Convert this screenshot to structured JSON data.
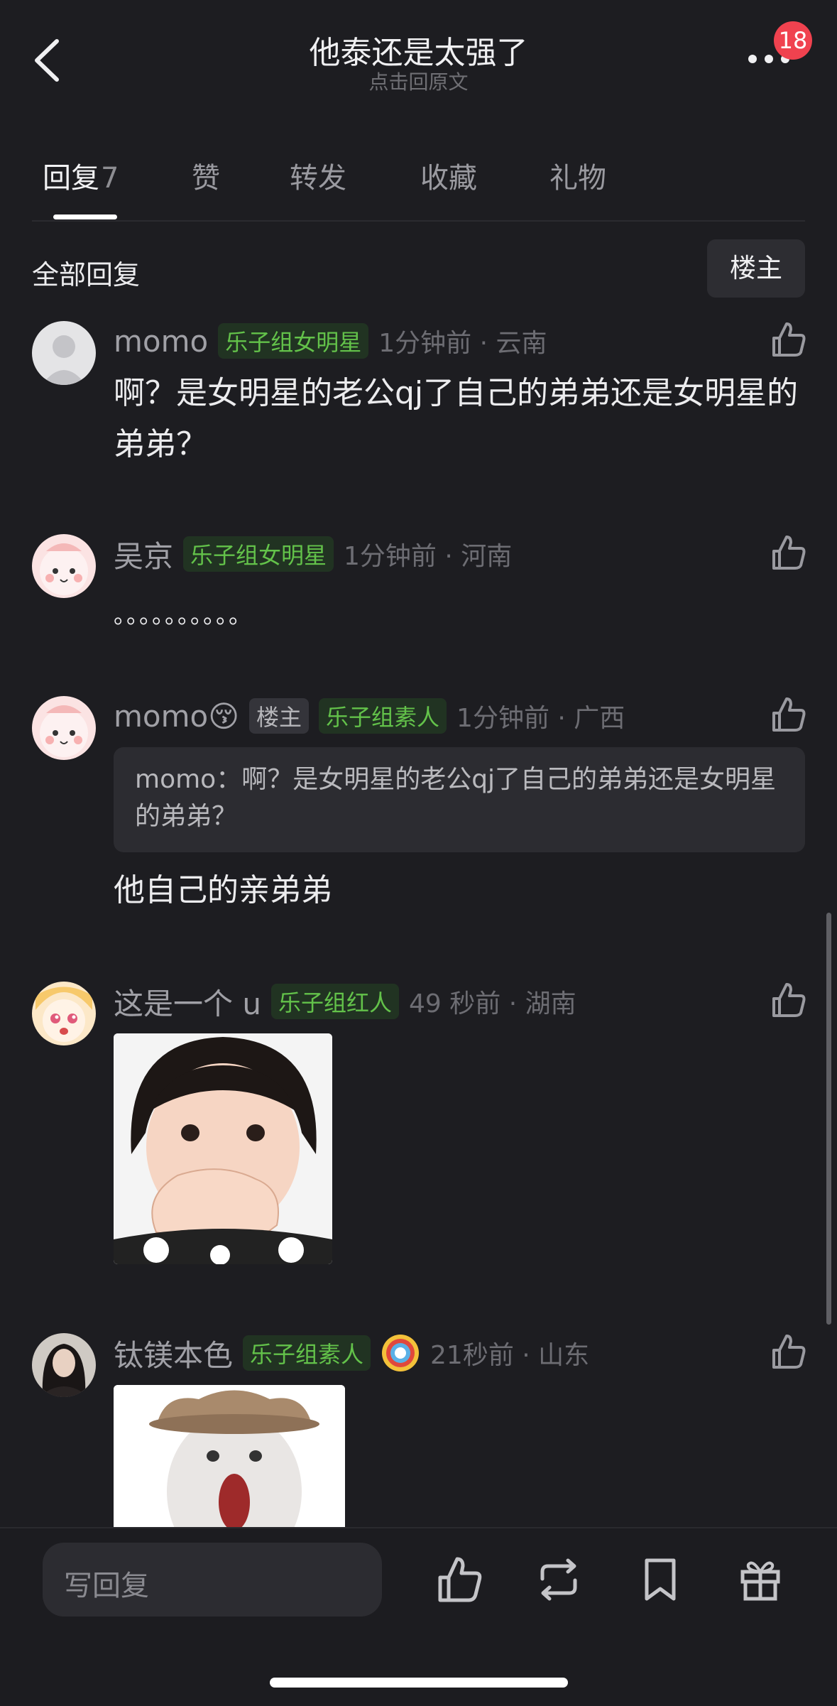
{
  "header": {
    "title": "他泰还是太强了",
    "subtitle": "点击回原文",
    "badge": "18"
  },
  "tabs": [
    {
      "label": "回复",
      "count": "7"
    },
    {
      "label": "赞"
    },
    {
      "label": "转发"
    },
    {
      "label": "收藏"
    },
    {
      "label": "礼物"
    }
  ],
  "section": {
    "title": "全部回复",
    "op_button": "楼主"
  },
  "comments": [
    {
      "name": "momo",
      "tag": "乐子组女明星",
      "meta": "1分钟前 · 云南",
      "text": "啊？是女明星的老公qj了自己的弟弟还是女明星的弟弟？"
    },
    {
      "name": "吴京",
      "tag": "乐子组女明星",
      "meta": "1分钟前 · 河南",
      "text": "。。。。。。。。。。"
    },
    {
      "name": "momo😚",
      "op_tag": "楼主",
      "tag": "乐子组素人",
      "meta": "1分钟前 · 广西",
      "quote": "momo：啊？是女明星的老公qj了自己的弟弟还是女明星的弟弟？",
      "text": "他自己的亲弟弟"
    },
    {
      "name": "这是一个 u",
      "tag": "乐子组红人",
      "meta": "49 秒前 · 湖南"
    },
    {
      "name": "钛镁本色",
      "tag": "乐子组素人",
      "meta": "21秒前 · 山东"
    }
  ],
  "bottom_bar": {
    "reply_placeholder": "写回复",
    "icons": [
      "like-icon",
      "repost-icon",
      "bookmark-icon",
      "gift-icon"
    ]
  },
  "colors": {
    "background": "#1d1d21",
    "tag_green": "#63c24a",
    "badge_red": "#f0424f"
  }
}
